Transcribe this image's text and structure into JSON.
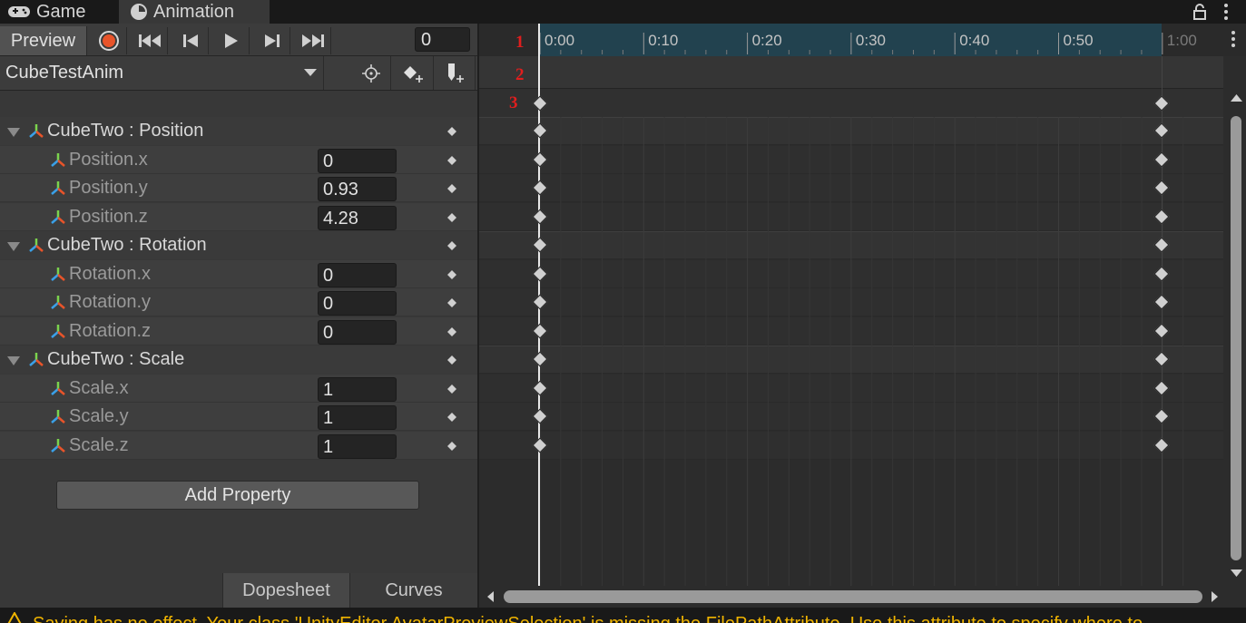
{
  "tabs": {
    "game": "Game",
    "animation": "Animation"
  },
  "toolbar": {
    "preview_label": "Preview",
    "frame_value": "0"
  },
  "clip": {
    "name": "CubeTestAnim"
  },
  "properties": [
    {
      "kind": "group",
      "label": "CubeTwo : Position"
    },
    {
      "kind": "child",
      "label": "Position.x",
      "value": "0"
    },
    {
      "kind": "child",
      "label": "Position.y",
      "value": "0.93"
    },
    {
      "kind": "child",
      "label": "Position.z",
      "value": "4.28"
    },
    {
      "kind": "group",
      "label": "CubeTwo : Rotation"
    },
    {
      "kind": "child",
      "label": "Rotation.x",
      "value": "0"
    },
    {
      "kind": "child",
      "label": "Rotation.y",
      "value": "0"
    },
    {
      "kind": "child",
      "label": "Rotation.z",
      "value": "0"
    },
    {
      "kind": "group",
      "label": "CubeTwo : Scale"
    },
    {
      "kind": "child",
      "label": "Scale.x",
      "value": "1"
    },
    {
      "kind": "child",
      "label": "Scale.y",
      "value": "1"
    },
    {
      "kind": "child",
      "label": "Scale.z",
      "value": "1"
    }
  ],
  "add_property_label": "Add Property",
  "bottom_tabs": {
    "dopesheet": "Dopesheet",
    "curves": "Curves"
  },
  "timeline": {
    "ticks": [
      "0:00",
      "0:10",
      "0:20",
      "0:30",
      "0:40",
      "0:50",
      "1:00"
    ],
    "keyframe_times": [
      "0:00",
      "1:00"
    ],
    "markers": [
      "1",
      "2",
      "3"
    ]
  },
  "status": {
    "message": "Saving has no effect. Your class 'UnityEditor.AvatarPreviewSelection' is missing the FilePathAttribute. Use this attribute to specify where to"
  },
  "colors": {
    "record": "#e8542a",
    "timeline_highlight": "#22424f",
    "warning": "#f0b400",
    "marker": "#e01e1e"
  }
}
